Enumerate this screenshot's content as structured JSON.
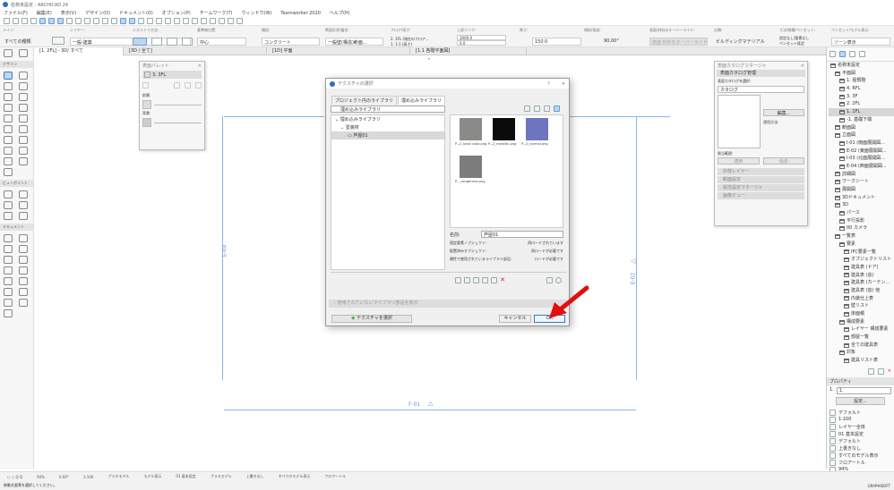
{
  "window": {
    "title": "名称未設定 - ARCHICAD 24"
  },
  "menu": [
    "ファイル(F)",
    "編集(E)",
    "表示(V)",
    "デザイン(D)",
    "ドキュメント(O)",
    "オプション(P)",
    "チームワーク(T)",
    "ウィンドウ(W)",
    "Teamworker 2020",
    "ヘルプ(H)"
  ],
  "toolbar_icons": [
    "undo",
    "redo",
    "pencil",
    "brush",
    "arrow",
    "snap",
    "guide",
    "grid",
    "rect",
    "rotate",
    "align",
    "text",
    "dim",
    "measure",
    "layers",
    "find",
    "zoom",
    "plan",
    "section",
    "elevation",
    "3d",
    "pen",
    "publish",
    "flag",
    "window",
    "layout",
    "settings"
  ],
  "infobox": {
    "main_label": "メイン:",
    "main_value": "すべての種類",
    "layer_label": "レイヤー:",
    "layer_value": "一般-建築",
    "geometry_label": "ジオメトリ方法:",
    "ref_label": "基準線位置:",
    "ref_value": "中心",
    "struct_label": "構造:",
    "struct_value": "コンクリート",
    "floor_label": "断面形状/複合:",
    "floor_value": "一般壁(構造)断面...",
    "story_label": "フロア/高さ:",
    "story_value": "2. 2FL (現在のフロア...",
    "story_value2": "1. 1:1 (高さ)",
    "height_label": "上部リンク:",
    "height_value": "3000.0",
    "height_value2": "0.0",
    "thickness_label": "厚さ:",
    "thickness_value": "150.0",
    "angle_label": "傾斜/角度:",
    "angle_value": "90.00°",
    "surface_label": "表面/材料のオーバーライド:",
    "surface_value": "表面 材料をオーバーライド",
    "composite_label": "分類:",
    "composite_value": "ビルディングマテリアル",
    "pen_label": "寸法/線種/ペンセット:",
    "pen_value": "設定なし/要素なし",
    "pen_value2": "ペンセット既定",
    "func_label": "ペンセット/モデル表示:",
    "func_value": "ゾーン表示"
  },
  "view_tabs": [
    {
      "label": "[1. 2FL] - 3D/ すべて"
    },
    {
      "label": "[3D / 全て]"
    },
    {
      "label": "[1D] 平面"
    },
    {
      "label": "[1.1 各階平面図]"
    }
  ],
  "toolbox": {
    "top": [
      "arrow",
      "marquee"
    ],
    "design_label": "デザイン",
    "design": [
      "wall",
      "column",
      "beam",
      "slab",
      "roof",
      "shell",
      "morph",
      "mesh",
      "curtain-wall",
      "door",
      "window",
      "skylight",
      "stair",
      "railing",
      "object",
      "lamp",
      "zone",
      "wall-end",
      "corner-window"
    ],
    "viewpoint_label": "ビューポイント",
    "viewpoint": [
      "section",
      "elevation",
      "interior-elev",
      "worksheet",
      "detail",
      "change"
    ],
    "document_label": "ドキュメント",
    "document": [
      "dimension",
      "level-dim",
      "radial-dim",
      "angle-dim",
      "spot-elev",
      "text",
      "label",
      "fill",
      "line",
      "arc",
      "polyline",
      "spline",
      "hotspot",
      "figure",
      "drawing"
    ]
  },
  "pen_palette": {
    "title": "表面パレット",
    "row": "3. 3FL",
    "color_label": "前景:",
    "bg_label": "背景:"
  },
  "right_palette": {
    "title": "表面カタログマネージャ",
    "section1": "表面カタログ管理",
    "select_label": "表面カタログを選択:",
    "select_value": "カタログ",
    "edit_btn": "編集...",
    "apply_label": "適用方法:",
    "assign_label": "割当範囲:",
    "apply_btn": "適用",
    "clear_btn": "消去",
    "sections": [
      "外部レイヤー",
      "断面設定",
      "属性設定マネージャ",
      "画像ビュー"
    ]
  },
  "navigator": {
    "items": [
      {
        "label": "名称未設定",
        "level": 0
      },
      {
        "label": "平面図",
        "level": 1
      },
      {
        "label": "1. 屋根階",
        "level": 2
      },
      {
        "label": "4. RFL",
        "level": 2
      },
      {
        "label": "3. 3F",
        "level": 2
      },
      {
        "label": "2. 2FL",
        "level": 2
      },
      {
        "label": "1. 1FL",
        "level": 2,
        "selected": true
      },
      {
        "label": "-1. 基礎下端",
        "level": 2
      },
      {
        "label": "断面図",
        "level": 1
      },
      {
        "label": "立面図",
        "level": 1
      },
      {
        "label": "I-01 (南面展開図...",
        "level": 2
      },
      {
        "label": "E-02 (東面展開図...",
        "level": 2
      },
      {
        "label": "I-03 (北面展開図...",
        "level": 2
      },
      {
        "label": "E-04 (西面展開図...",
        "level": 2
      },
      {
        "label": "詳細図",
        "level": 1
      },
      {
        "label": "ワークシート",
        "level": 1
      },
      {
        "label": "展開図",
        "level": 1
      },
      {
        "label": "3Dドキュメント",
        "level": 1
      },
      {
        "label": "3D",
        "level": 1
      },
      {
        "label": "パース",
        "level": 2
      },
      {
        "label": "平行投影",
        "level": 2
      },
      {
        "label": "00 カメラ",
        "level": 2
      },
      {
        "label": "一覧表",
        "level": 1
      },
      {
        "label": "要素",
        "level": 2
      },
      {
        "label": "IFC要素一覧",
        "level": 3
      },
      {
        "label": "オブジェクトリスト",
        "level": 3
      },
      {
        "label": "建具表 (ドア)",
        "level": 3
      },
      {
        "label": "建具表 (窓)",
        "level": 3
      },
      {
        "label": "建具表 (カーテン...",
        "level": 3
      },
      {
        "label": "建具表 (窓) 他",
        "level": 3
      },
      {
        "label": "内装仕上表",
        "level": 3
      },
      {
        "label": "壁リスト",
        "level": 3
      },
      {
        "label": "床面積",
        "level": 3
      },
      {
        "label": "構成要素",
        "level": 2
      },
      {
        "label": "レイヤー 構成要素",
        "level": 3
      },
      {
        "label": "部屋一覧",
        "level": 3
      },
      {
        "label": "全ての建具表",
        "level": 3
      },
      {
        "label": "対象",
        "level": 2
      },
      {
        "label": "建具リスト表",
        "level": 3
      }
    ],
    "props_header": "プロパティ",
    "props_id": "1.",
    "props_name": "1.",
    "props_btn": "設定...",
    "props": [
      "デフォルト",
      "1:100",
      "レイヤー全体",
      "01 基本設定",
      "デフォルト",
      "上書きなし",
      "すべてのモデル表示",
      "フロアートル",
      "94%",
      "0.00°"
    ]
  },
  "dialog": {
    "title": "テクスチャの選択",
    "tabs": [
      "プロジェクト内のライブラリ",
      "埋め込みライブラリ"
    ],
    "folder_select": "埋め込みライブラリ",
    "tree": [
      "埋め込みライブラリ",
      "塗装材",
      "芦屋01"
    ],
    "thumbs": [
      {
        "caption": "P...2_base color.png",
        "color": "#8a8a88"
      },
      {
        "caption": "P...2_metallic.png",
        "color": "#0b0b0b"
      },
      {
        "caption": "P...2_normal.png",
        "color": "#6f74c0"
      },
      {
        "caption": "P..._roughness.png",
        "color": "#7c7c7c"
      }
    ],
    "name_label": "名前:",
    "name_value": "芦屋01",
    "info_rows": [
      {
        "k": "固定要素ノブジェクト:",
        "v": "再ロードされています"
      },
      {
        "k": "配置済みオブジェクト:",
        "v": "再ロードが必要です"
      },
      {
        "k": "属性で使用されているライブラリ部品:",
        "v": "ロードが必要です"
      }
    ],
    "collapsed": "使用されていないライブラリ部品を表示",
    "select_btn": "テクスチャを選択",
    "cancel": "キャンセル",
    "ok": "OK"
  },
  "canvas": {
    "labels": [
      "E-04",
      "E-02",
      "F-01"
    ],
    "arrow_color": "#e01010"
  },
  "status": {
    "zoom": "94%",
    "angle": "0.00°",
    "scale": "1:100",
    "layers": "プラスモデル",
    "pens": "モデル表示",
    "override": "01 基本設定",
    "mvo": "プラスモデル",
    "renov": "上書きなし",
    "structure": "すべてのモデル表示",
    "dims": "フロアートル",
    "hint": "移動先要素を選択してください。",
    "brand": "GRAPHISOFT"
  }
}
